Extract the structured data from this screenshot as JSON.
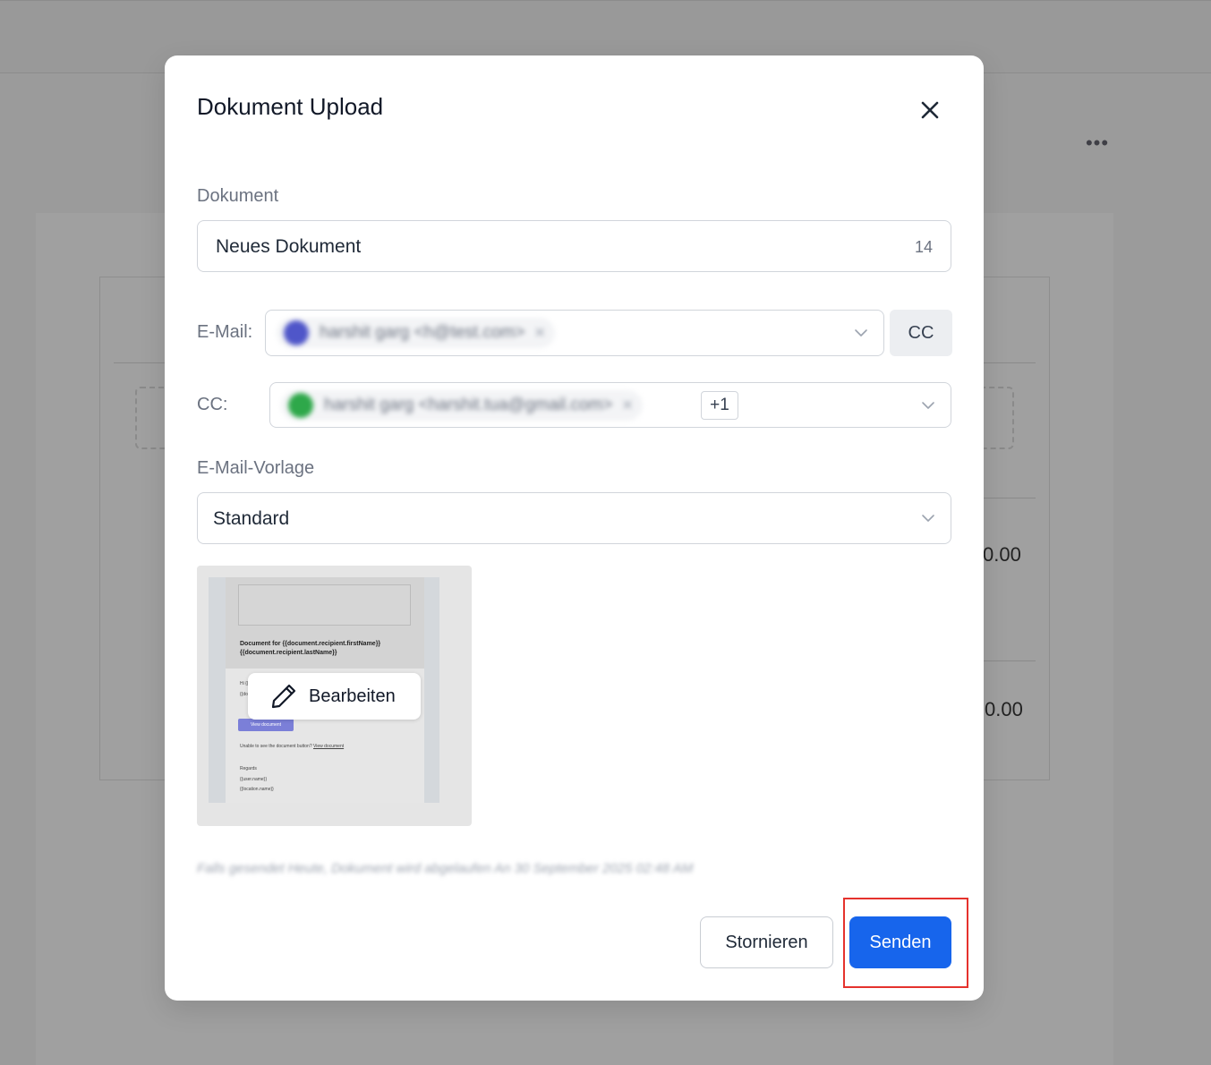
{
  "background": {
    "amount_1": "0.00",
    "amount_2": "0.00",
    "more_icon": "ellipsis-icon"
  },
  "modal": {
    "title": "Dokument Upload",
    "close_icon": "close-icon",
    "document": {
      "label": "Dokument",
      "value": "Neues Dokument",
      "char_count": "14"
    },
    "email": {
      "label": "E-Mail:",
      "recipient": "harshit garg <h@test.com>",
      "avatar_color": "#4f56c9",
      "cc_button": "CC"
    },
    "cc": {
      "label": "CC:",
      "recipient": "harshit garg <harshit.tua@gmail.com>",
      "avatar_color": "#2ea84a",
      "more_count": "+1"
    },
    "template": {
      "label": "E-Mail-Vorlage",
      "value": "Standard"
    },
    "preview": {
      "doc_title": "Document for {{document.recipient.firstName}} {{document.recipient.lastName}}",
      "greeting": "Hi {{",
      "greeting2": "{{do",
      "view_button": "View document",
      "unable_text": "Unable to see the document button?",
      "unable_link": "View document",
      "regards": "Regards",
      "user_name": "{{user.name}}",
      "location_name": "{{location.name}}",
      "edit_button": "Bearbeiten"
    },
    "note": "Falls gesendet Heute, Dokument wird abgelaufen An 30 September 2025 02:48 AM",
    "cancel_button": "Stornieren",
    "send_button": "Senden"
  },
  "colors": {
    "primary": "#1765ec",
    "highlight": "#e5322d"
  }
}
